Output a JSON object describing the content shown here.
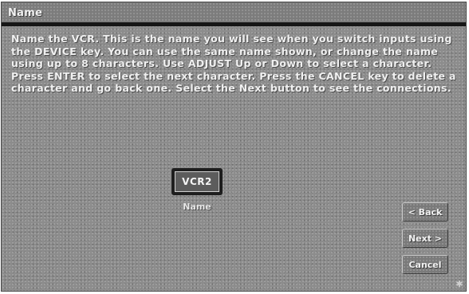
{
  "dialog": {
    "title": "Name",
    "instructions": "Name the VCR. This is the name you will see when you switch inputs using the DEVICE key. You can use the same name shown, or change the name using up to 8 characters. Use ADJUST Up or Down to select a character. Press ENTER to select the next character. Press the CANCEL key to delete a character and go back one. Select the Next button to see the connections.",
    "name_field": {
      "value": "VCR2",
      "caption": "Name"
    },
    "buttons": {
      "back": "< Back",
      "next": "Next >",
      "cancel": "Cancel"
    }
  },
  "icons": {
    "resize_grip": "resize-grip-icon"
  },
  "colors": {
    "panel": "#8c8c8c",
    "title_rule": "#161616",
    "field_bg": "#1e1e1e",
    "text": "#f0f0f0"
  }
}
